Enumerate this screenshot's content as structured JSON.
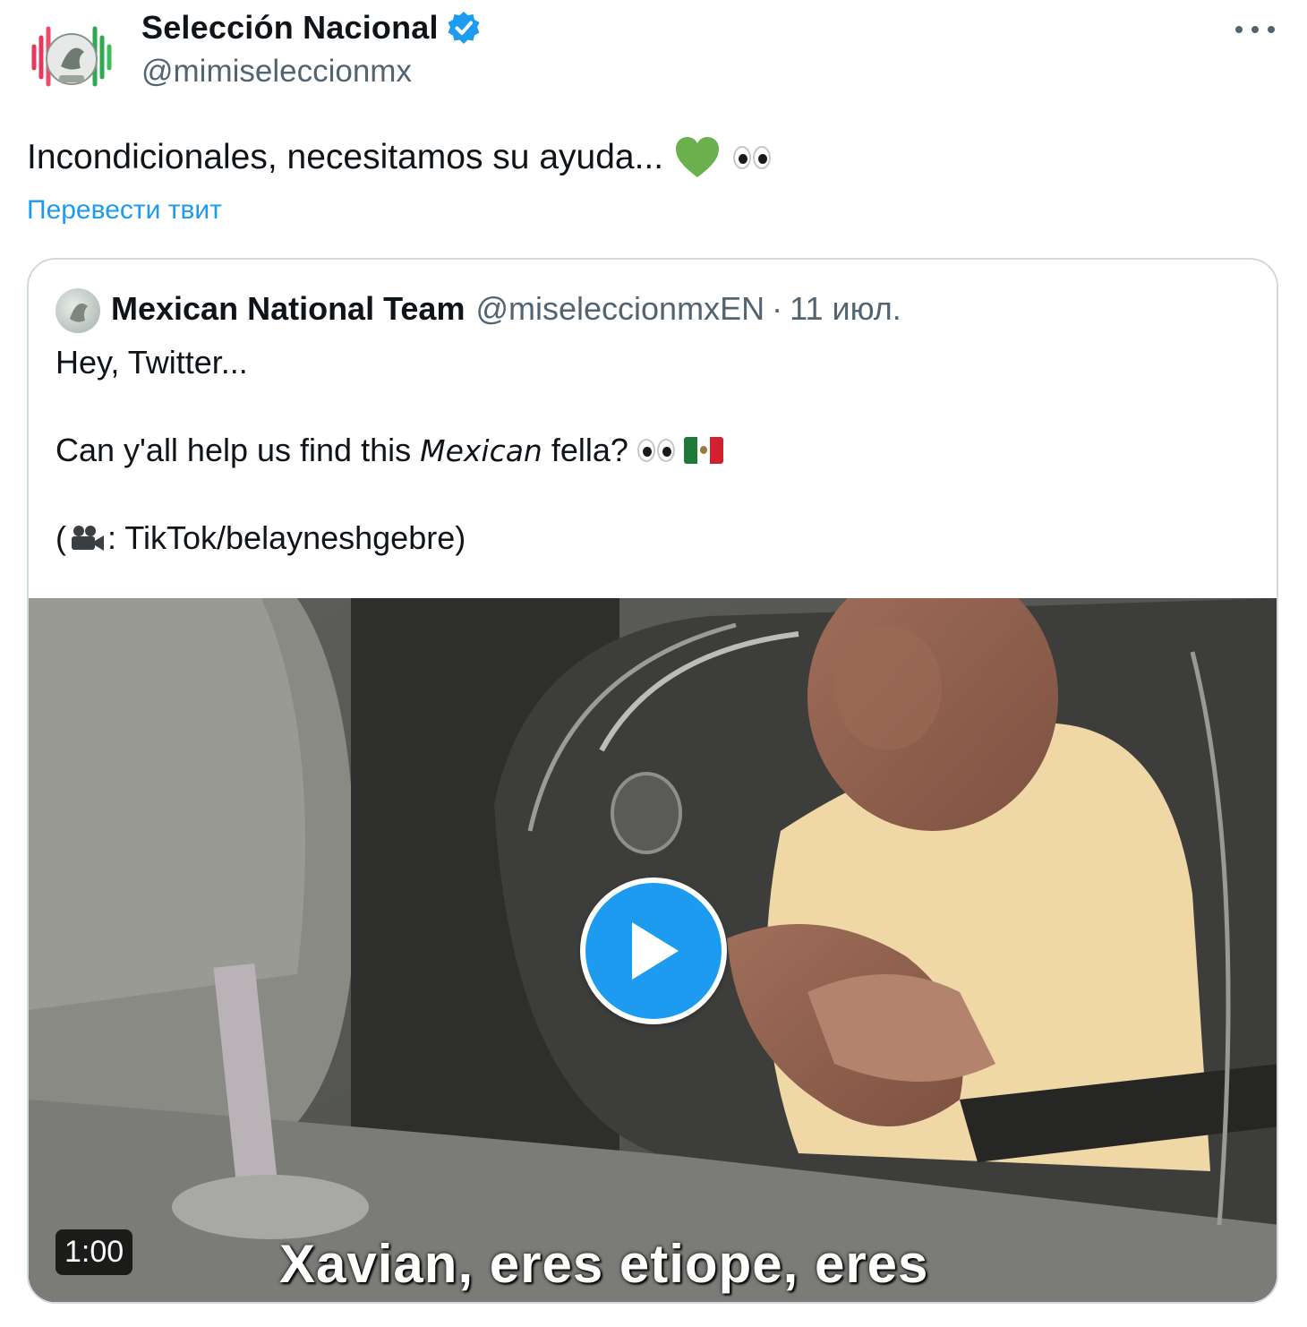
{
  "author": {
    "display_name": "Selección Nacional",
    "handle": "@mimiseleccionmx"
  },
  "tweet": {
    "text": "Incondicionales, necesitamos su ayuda...",
    "translate_label": "Перевести твит"
  },
  "quote": {
    "display_name": "Mexican National Team",
    "handle": "@miseleccionmxEN",
    "separator": "·",
    "date": "11 июл.",
    "line1": "Hey, Twitter...",
    "line2_pre": "Can y'all help us find this",
    "line2_italic": "Mexican",
    "line2_post": "fella?",
    "line3_open": "(",
    "line3_rest": ": TikTok/belayneshgebre)"
  },
  "media": {
    "duration": "1:00",
    "caption": "Xavian, eres etiope, eres"
  },
  "colors": {
    "accent": "#1d9bf0",
    "text": "#0f1419",
    "secondary": "#536471",
    "heart": "#6ab04c"
  },
  "icons": {
    "verified": "verified-badge-icon",
    "more": "more-dots-icon",
    "heart": "green-heart-icon",
    "eyes": "eyes-icon",
    "flag": "mexico-flag-icon",
    "camera": "movie-camera-icon",
    "play": "play-icon"
  }
}
